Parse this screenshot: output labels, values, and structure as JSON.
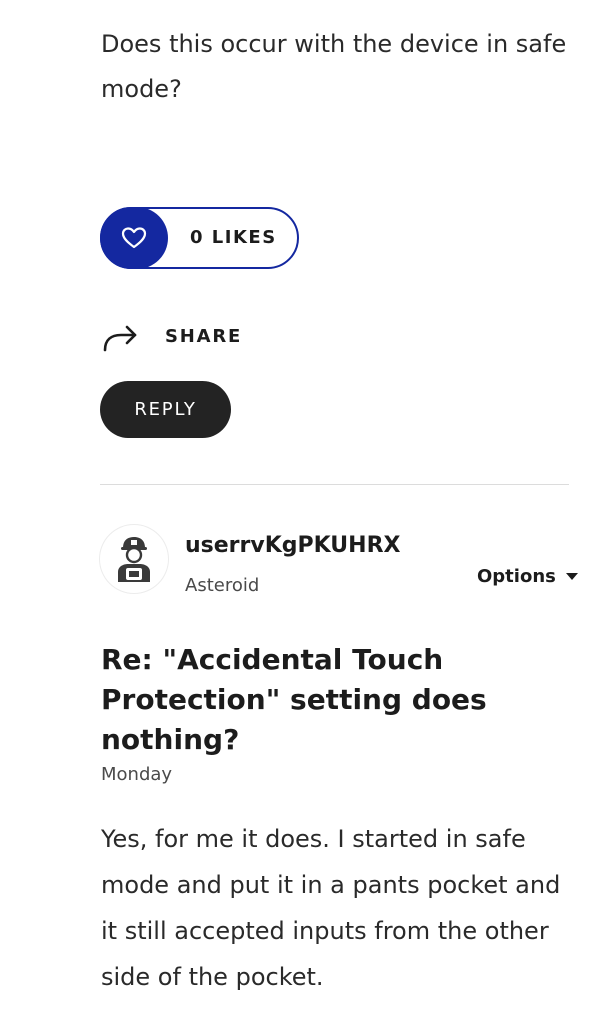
{
  "previous_post": {
    "body": "Does this occur with the device in safe mode?",
    "likes_label": "0 LIKES",
    "share_label": "SHARE",
    "reply_label": "REPLY"
  },
  "reply_post": {
    "author": {
      "username": "userrvKgPKUHRX",
      "rank": "Asteroid"
    },
    "options_label": "Options",
    "title": "Re: \"Accidental Touch Protection\" setting does nothing?",
    "date": "Monday",
    "body": "Yes, for me it does. I started in safe mode and put it in a pants pocket and it still accepted inputs from the other side of the pocket."
  },
  "icons": {
    "like": "heart-icon",
    "share": "share-arrow-icon",
    "avatar": "user-avatar-icon",
    "options": "caret-down-icon"
  },
  "colors": {
    "accent": "#1428a0",
    "reply_button": "#232323",
    "text": "#1c1c1c"
  }
}
